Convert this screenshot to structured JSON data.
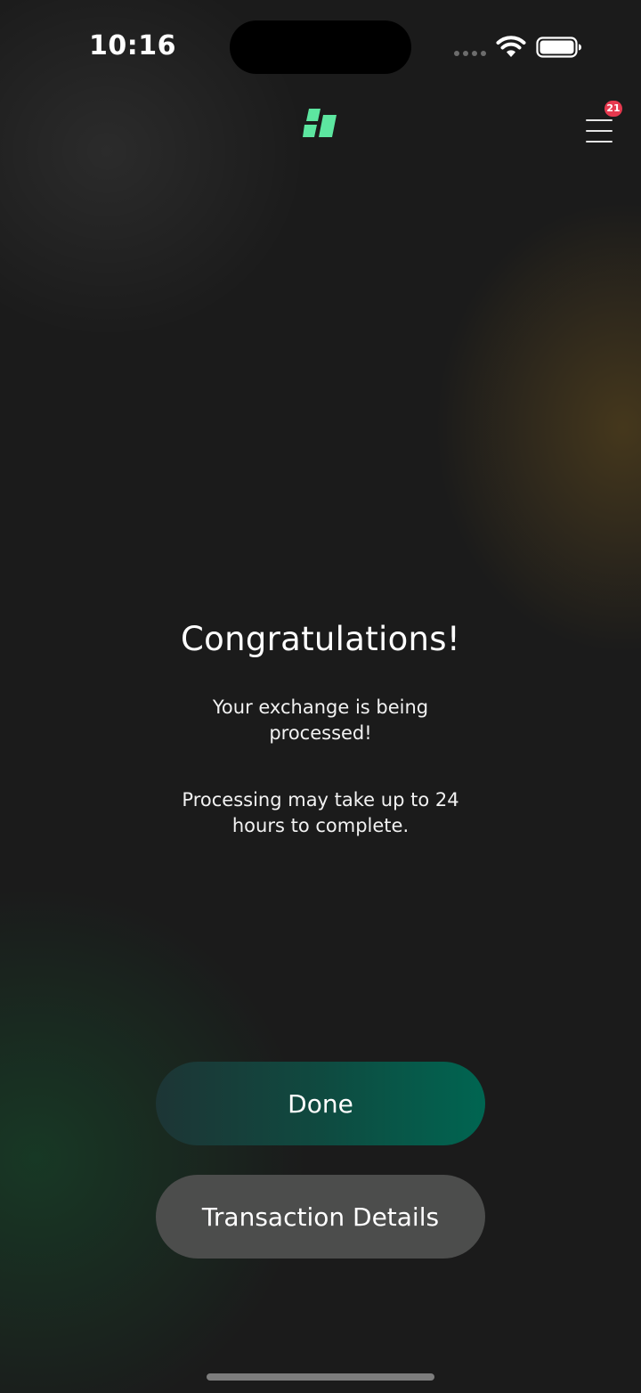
{
  "status_bar": {
    "time": "10:16"
  },
  "header": {
    "logo_icon": "brand-logo-icon",
    "menu_icon": "hamburger-menu-icon",
    "notification_count": "21"
  },
  "main": {
    "title": "Congratulations!",
    "message_1": "Your exchange is being processed!",
    "message_2": "Processing may take up to 24 hours to complete."
  },
  "actions": {
    "done_label": "Done",
    "details_label": "Transaction Details"
  },
  "colors": {
    "brand_green": "#5de6a0",
    "badge_red": "#e6394f",
    "done_button_accent": "#006551",
    "secondary_button": "#4c4d4c",
    "background": "#1b1b1b"
  }
}
